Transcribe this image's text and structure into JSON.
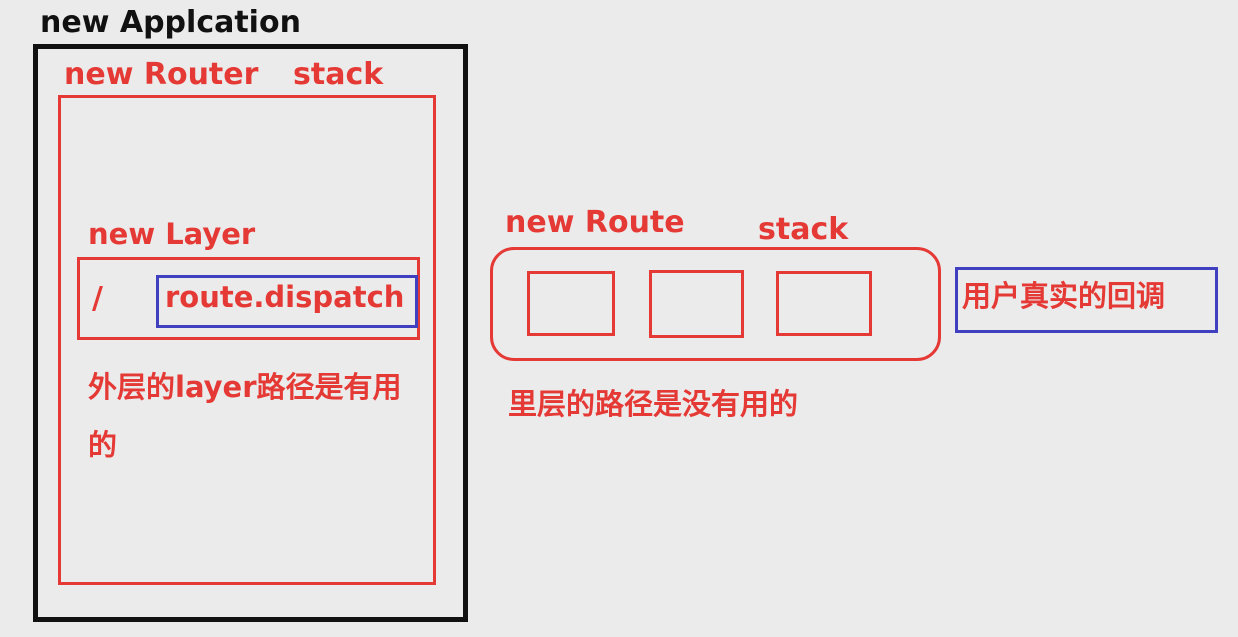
{
  "application": {
    "label": "new Applcation"
  },
  "router": {
    "label": "new Router",
    "stack_label": "stack"
  },
  "layer": {
    "label": "new Layer",
    "path": "/",
    "handler": "route.dispatch",
    "note": "外层的layer路径是有用的"
  },
  "route": {
    "label": "new Route",
    "stack_label": "stack",
    "note": "里层的路径是没有用的"
  },
  "callback": {
    "label": "用户真实的回调"
  },
  "colors": {
    "application": "#111111",
    "router": "#e53935",
    "text_red": "#e53935",
    "handler_border": "#3f3fbf",
    "background": "#ebebeb"
  }
}
